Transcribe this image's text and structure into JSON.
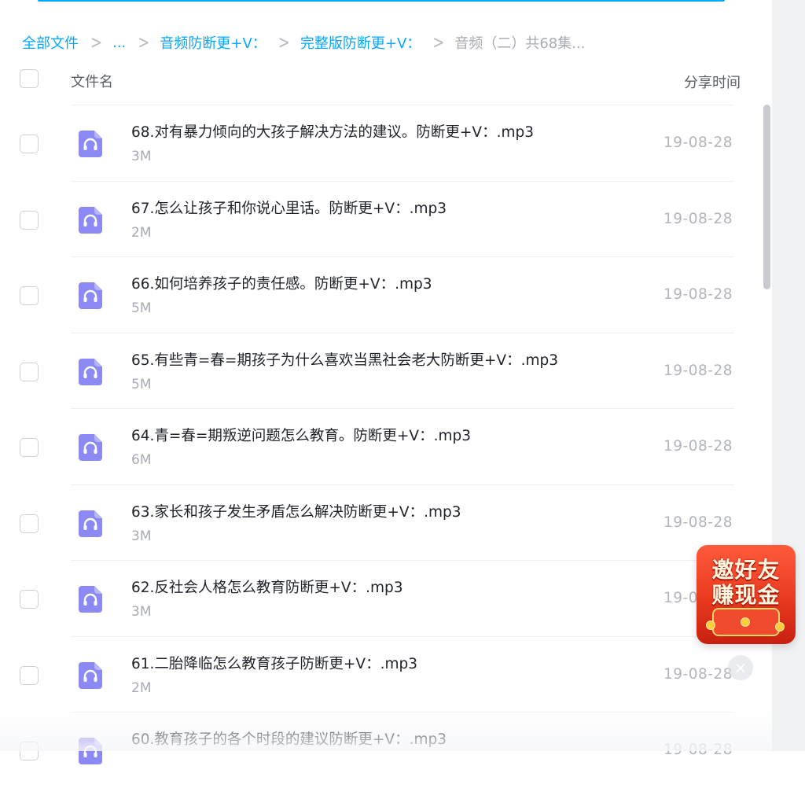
{
  "breadcrumb": {
    "items": [
      "全部文件",
      "...",
      "音频防断更+V：",
      "完整版防断更+V："
    ],
    "current": "音频（二）共68集...",
    "separator": ">"
  },
  "header": {
    "name_col": "文件名",
    "time_col": "分享时间"
  },
  "files": [
    {
      "name": "68.对有暴力倾向的大孩子解决方法的建议。防断更+V：.mp3",
      "size": "3M",
      "time": "19-08-28"
    },
    {
      "name": "67.怎么让孩子和你说心里话。防断更+V：.mp3",
      "size": "2M",
      "time": "19-08-28"
    },
    {
      "name": "66.如何培养孩子的责任感。防断更+V：.mp3",
      "size": "5M",
      "time": "19-08-28"
    },
    {
      "name": "65.有些青=春=期孩子为什么喜欢当黑社会老大防断更+V：.mp3",
      "size": "5M",
      "time": "19-08-28"
    },
    {
      "name": "64.青=春=期叛逆问题怎么教育。防断更+V：.mp3",
      "size": "6M",
      "time": "19-08-28"
    },
    {
      "name": "63.家长和孩子发生矛盾怎么解决防断更+V：.mp3",
      "size": "3M",
      "time": "19-08-28"
    },
    {
      "name": "62.反社会人格怎么教育防断更+V：.mp3",
      "size": "3M",
      "time": "19-08-28"
    },
    {
      "name": "61.二胎降临怎么教育孩子防断更+V：.mp3",
      "size": "2M",
      "time": "19-08-28"
    },
    {
      "name": "60.教育孩子的各个时段的建议防断更+V：.mp3",
      "size": "",
      "time": "19-08-28"
    }
  ],
  "promo": {
    "line1": "邀好友",
    "line2": "赚现金",
    "close_icon": "close-icon"
  },
  "icons": {
    "file": "audio-file-icon"
  },
  "colors": {
    "accent": "#06a7ff",
    "file_icon": "#8c89f5",
    "promo": "#e83a1f"
  }
}
